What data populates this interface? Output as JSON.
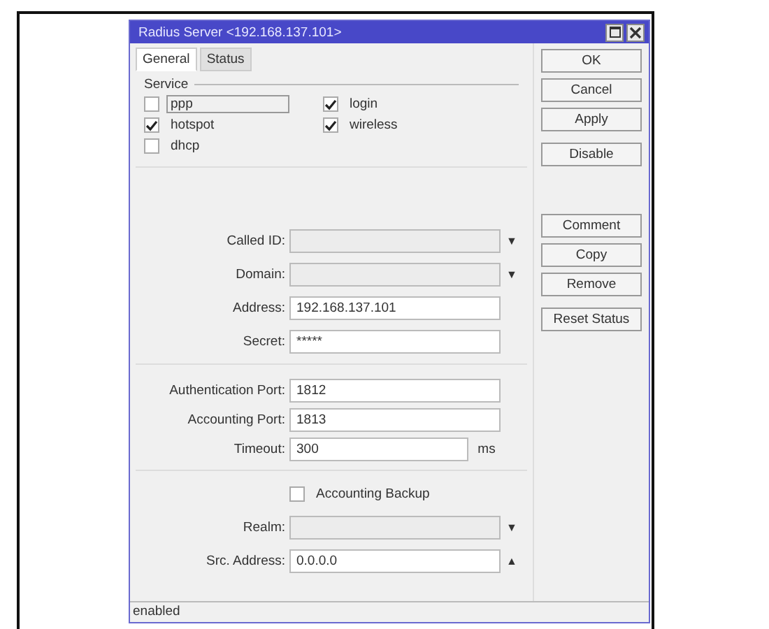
{
  "window": {
    "title": "Radius Server <192.168.137.101>"
  },
  "tabs": [
    {
      "label": "General",
      "selected": true
    },
    {
      "label": "Status",
      "selected": false
    }
  ],
  "service": {
    "label": "Service",
    "options": [
      {
        "label": "ppp",
        "checked": false,
        "focused": true
      },
      {
        "label": "login",
        "checked": true,
        "focused": false
      },
      {
        "label": "hotspot",
        "checked": true,
        "focused": false
      },
      {
        "label": "wireless",
        "checked": true,
        "focused": false
      },
      {
        "label": "dhcp",
        "checked": false,
        "focused": false
      }
    ]
  },
  "fields_a": [
    {
      "label": "Called ID:",
      "kind": "combo",
      "trailing": "▼"
    },
    {
      "label": "Domain:",
      "kind": "combo",
      "trailing": "▼"
    },
    {
      "label": "Address:",
      "kind": "text",
      "value": "192.168.137.101"
    },
    {
      "label": "Secret:",
      "kind": "text",
      "value": "*****"
    }
  ],
  "fields_b": [
    {
      "label": "Authentication Port:",
      "kind": "text",
      "value": "1812"
    },
    {
      "label": "Accounting Port:",
      "kind": "text",
      "value": "1813"
    },
    {
      "label": "Timeout:",
      "kind": "text",
      "value": "300",
      "unit": "ms"
    }
  ],
  "accounting_backup": {
    "label": "Accounting Backup",
    "checked": false
  },
  "fields_c": [
    {
      "label": "Realm:",
      "kind": "combo",
      "trailing": "▼"
    },
    {
      "label": "Src. Address:",
      "kind": "text",
      "value": "0.0.0.0",
      "trailing": "▲"
    }
  ],
  "button_groups": [
    [
      "OK",
      "Cancel",
      "Apply"
    ],
    [
      "Disable"
    ],
    [
      "Comment",
      "Copy",
      "Remove"
    ],
    [
      "Reset Status"
    ]
  ],
  "status_bar": "enabled"
}
